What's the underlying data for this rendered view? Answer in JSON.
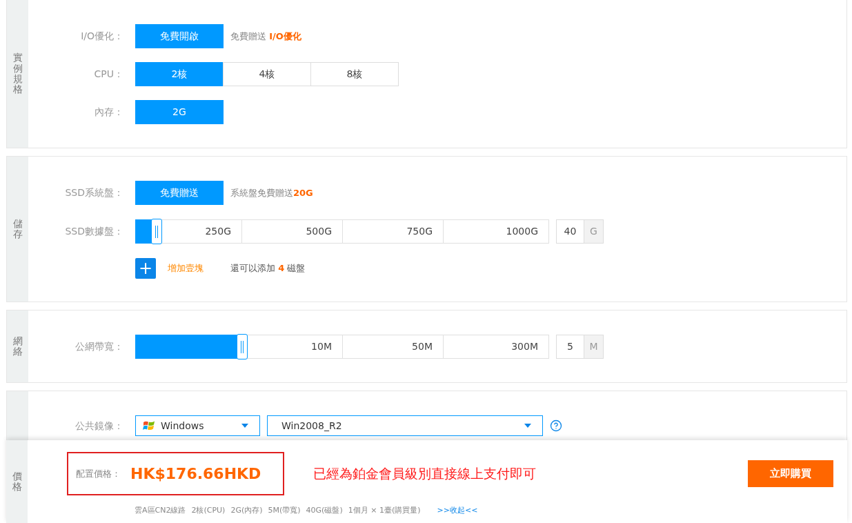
{
  "sections": [
    {
      "label": "實例規格",
      "rows": [
        {
          "kind": "options",
          "label": "I/O優化：",
          "options": [
            {
              "text": "免費開啟",
              "selected": true
            }
          ],
          "note": "免費贈送 **I/O優化**"
        },
        {
          "kind": "options",
          "label": "CPU：",
          "options": [
            {
              "text": "2核",
              "selected": true
            },
            {
              "text": "4核",
              "selected": false
            },
            {
              "text": "8核",
              "selected": false
            }
          ]
        },
        {
          "kind": "options",
          "label": "內存：",
          "options": [
            {
              "text": "2G",
              "selected": true
            }
          ]
        }
      ]
    },
    {
      "label": "儲存",
      "rows": [
        {
          "kind": "options",
          "label": "SSD系統盤：",
          "options": [
            {
              "text": "免費贈送",
              "selected": true
            }
          ],
          "note": "系統盤免費贈送**20G**"
        },
        {
          "kind": "slider",
          "label": "SSD數據盤：",
          "level": 0.05,
          "ticks": [
            "250G",
            "500G",
            "750G",
            "1000G"
          ],
          "value": "40",
          "unit": "G"
        },
        {
          "kind": "add",
          "button": "+",
          "link": "增加壹塊",
          "note": "還可以添加 **4** 磁盤"
        }
      ]
    },
    {
      "label": "網絡",
      "rows": [
        {
          "kind": "slider",
          "label": "公網帶寬：",
          "level": 0.257,
          "ticks": [
            "10M",
            "50M",
            "300M"
          ],
          "value": "5",
          "unit": "M"
        }
      ]
    },
    {
      "rows": [
        {
          "kind": "selects",
          "label": "公共鏡像：",
          "selects": [
            {
              "kind": "os",
              "value": "Windows"
            },
            {
              "kind": "version",
              "value": "Win2008_R2"
            }
          ]
        }
      ]
    }
  ],
  "footer": {
    "label": "價格",
    "price_label": "配置價格：",
    "price": "HK$176.66HKD",
    "notice": "已經為鉑金會員級別直接線上支付即可",
    "buy_button": "立即購買",
    "summary": [
      "雲A區CN2線路",
      "2核(CPU)",
      "2G(內存)",
      "5M(帶寬)",
      "40G(磁盤)",
      "1個月 × 1臺(購買量)"
    ],
    "collapse_link": ">>收起<<"
  }
}
